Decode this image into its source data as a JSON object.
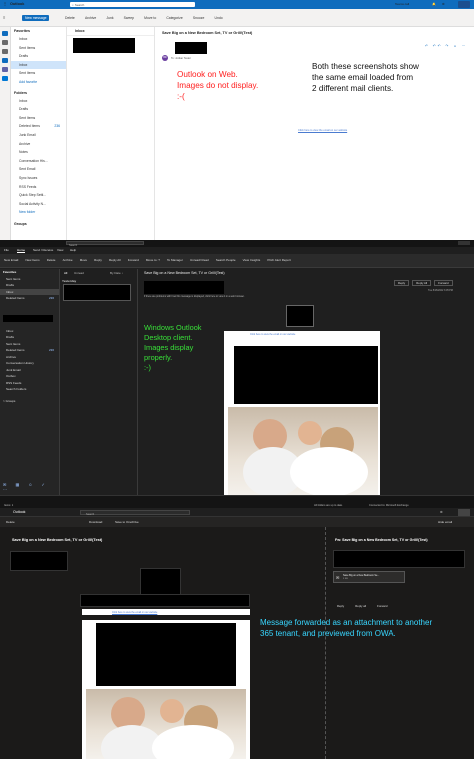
{
  "panel_web": {
    "app_name": "Outlook",
    "search_placeholder": "Search",
    "meet_now": "Teams call",
    "new_message": "New message",
    "commands": [
      "Delete",
      "Archive",
      "Junk",
      "Sweep",
      "Move to",
      "Categorize",
      "Snooze",
      "Undo"
    ],
    "folders_header": "Favorites",
    "favorites": [
      {
        "label": "Inbox",
        "count": ""
      },
      {
        "label": "Sent Items",
        "count": ""
      },
      {
        "label": "Drafts",
        "count": ""
      },
      {
        "label": "Inbox",
        "count": "",
        "selected": true
      },
      {
        "label": "Sent Items",
        "count": ""
      },
      {
        "label": "Add favorite",
        "count": ""
      }
    ],
    "folders_header2": "Folders",
    "folders": [
      {
        "label": "Inbox",
        "count": ""
      },
      {
        "label": "Drafts",
        "count": ""
      },
      {
        "label": "Sent Items",
        "count": ""
      },
      {
        "label": "Deleted Items",
        "count": "236"
      },
      {
        "label": "Junk Email",
        "count": ""
      },
      {
        "label": "Archive",
        "count": ""
      },
      {
        "label": "Notes",
        "count": ""
      },
      {
        "label": "Conversation His...",
        "count": ""
      },
      {
        "label": "Sent Email",
        "count": ""
      },
      {
        "label": "Sync Issues",
        "count": ""
      },
      {
        "label": "RSS Feeds",
        "count": ""
      },
      {
        "label": "Quick Step Setti...",
        "count": ""
      },
      {
        "label": "Social Activity N...",
        "count": ""
      },
      {
        "label": "New folder",
        "count": ""
      }
    ],
    "groups_label": "Groups",
    "list_tab": "Inbox",
    "subject": "Save Big on a New Bedroom Set, TV or Grill!(Test)",
    "sender_initials": "BD",
    "sender_to": "To: Jordan Tester",
    "annotation_lines": [
      "Outlook on Web.",
      "Images do not display.",
      ":-("
    ],
    "note_lines": [
      "Both these screenshots show",
      "the same email loaded from",
      "2 different mail clients."
    ],
    "view_link": "Click here to view the email on our website"
  },
  "panel_desktop": {
    "tabs": [
      "File",
      "Home",
      "Send / Receive",
      "View",
      "Help"
    ],
    "search_placeholder": "Search",
    "ribbon": [
      "New Email",
      "New Items",
      "Delete",
      "Archive",
      "Move",
      "Reply",
      "Reply All",
      "Forward",
      "Move to: ?",
      "To Manager",
      "Unread/ Read",
      "Search People",
      "View Insights",
      "Pitch Alert Report"
    ],
    "favorites_label": "Favorites",
    "favorites": [
      {
        "label": "Sent Items",
        "count": ""
      },
      {
        "label": "Drafts",
        "count": ""
      },
      {
        "label": "Inbox",
        "count": "",
        "selected": true
      },
      {
        "label": "Deleted Items",
        "count": "236"
      }
    ],
    "folders": [
      {
        "label": "Inbox",
        "count": ""
      },
      {
        "label": "Drafts",
        "count": ""
      },
      {
        "label": "Sent Items",
        "count": ""
      },
      {
        "label": "Deleted Items",
        "count": "236"
      },
      {
        "label": "Archive",
        "count": ""
      },
      {
        "label": "Conversation History",
        "count": ""
      },
      {
        "label": "Junk Email",
        "count": ""
      },
      {
        "label": "Outbox",
        "count": ""
      },
      {
        "label": "RSS Feeds",
        "count": ""
      },
      {
        "label": "Search Folders",
        "count": ""
      }
    ],
    "groups_label": "> Groups",
    "list_filters": [
      "All",
      "Unread",
      "By Date ↓"
    ],
    "list_group": "Yesterday",
    "subject": "Save Big on a New Bedroom Set, TV or Grill!(Test)",
    "actions": [
      "Reply",
      "Reply All",
      "Forward"
    ],
    "date": "Tue 8/16/2022 3:05 PM",
    "info_bar": "If there are problems with how this message is displayed, click here to view it in a web browser.",
    "view_link": "Click here to view the email on our website",
    "annotation_lines": [
      "Windows Outlook",
      "Desktop client.",
      "Images display",
      "properly.",
      ":-)"
    ],
    "status_left": "Items: 1",
    "status_mid": "All folders are up to date.",
    "status_right": "Connected to: Microsoft Exchange"
  },
  "panel_forward": {
    "app_name": "Outlook",
    "search_placeholder": "Search",
    "commands": [
      "Delete",
      "Download",
      "Save to OneDrive"
    ],
    "hide_email": "Hide email",
    "subject": "Save Big on a New Bedroom Set, TV or Grill!(Test)",
    "view_link": "Click here to view the email on our website",
    "fw_subject": "Fw: Save Big on a New Bedroom Set, TV or Grill!(Test)",
    "attachment_name": "Save Big on a New Bedroom Se...",
    "attachment_size": "3 KB",
    "fw_actions": [
      "Reply",
      "Reply all",
      "Forward"
    ],
    "annotation_lines": [
      "Message forwarded as an attachment to another",
      "365 tenant, and previewed from OWA."
    ]
  },
  "colors": {
    "owa_blue": "#0f6cbd",
    "annotation_red": "#ff2020",
    "annotation_green": "#38e038",
    "annotation_cyan": "#38d6ff",
    "link_blue": "#4a7bd0"
  }
}
